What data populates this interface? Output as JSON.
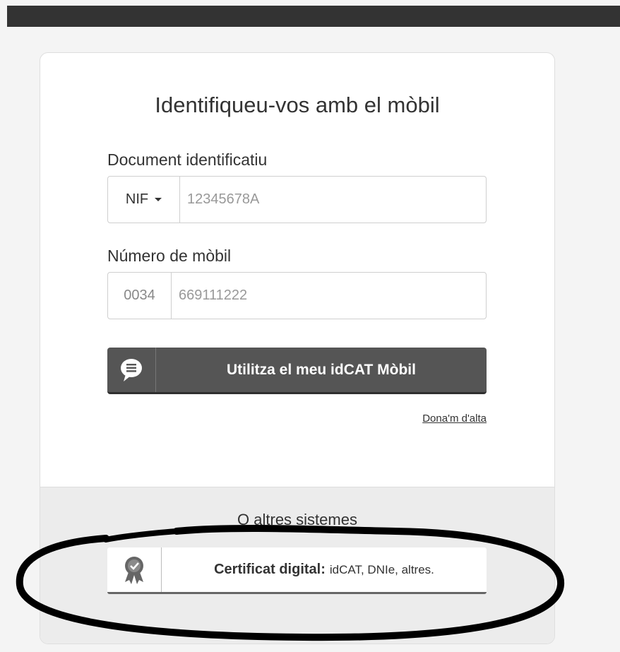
{
  "title": "Identifiqueu-vos amb el mòbil",
  "document": {
    "label": "Document identificatiu",
    "type_selected": "NIF",
    "placeholder": "12345678A"
  },
  "mobile": {
    "label": "Número de mòbil",
    "prefix": "0034",
    "placeholder": "669111222"
  },
  "primary_button": {
    "label": "Utilitza el meu idCAT Mòbil",
    "icon": "chat-bubble-icon"
  },
  "signup_link": "Dona'm d'alta",
  "other_systems": {
    "title": "O altres sistemes",
    "certificate_button": {
      "strong": "Certificat digital:",
      "rest": "idCAT, DNIe, altres.",
      "icon": "award-badge-icon"
    }
  },
  "colors": {
    "topbar": "#333333",
    "primary_button": "#555555",
    "annotation_stroke": "#000000"
  }
}
